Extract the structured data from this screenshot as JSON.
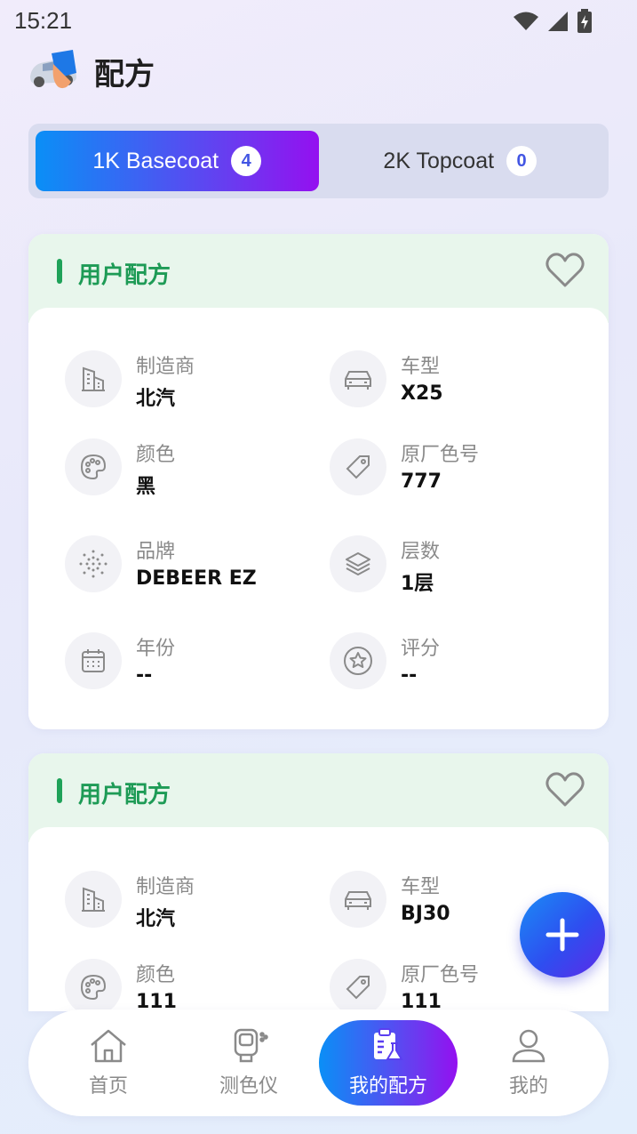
{
  "status_bar": {
    "time": "15:21"
  },
  "header": {
    "title": "配方"
  },
  "tabs": [
    {
      "label": "1K Basecoat",
      "count": "4",
      "active": true
    },
    {
      "label": "2K Topcoat",
      "count": "0",
      "active": false
    }
  ],
  "cards": [
    {
      "title": "用户配方",
      "fields": [
        {
          "icon": "building-icon",
          "label": "制造商",
          "value": "北汽"
        },
        {
          "icon": "car-icon",
          "label": "车型",
          "value": "X25"
        },
        {
          "icon": "palette-icon",
          "label": "颜色",
          "value": "黑"
        },
        {
          "icon": "tag-icon",
          "label": "原厂色号",
          "value": "777"
        },
        {
          "icon": "dots-circle-icon",
          "label": "品牌",
          "value": "DEBEER EZ"
        },
        {
          "icon": "layers-icon",
          "label": "层数",
          "value": "1层"
        },
        {
          "icon": "calendar-icon",
          "label": "年份",
          "value": "--"
        },
        {
          "icon": "star-icon",
          "label": "评分",
          "value": "--"
        }
      ]
    },
    {
      "title": "用户配方",
      "fields": [
        {
          "icon": "building-icon",
          "label": "制造商",
          "value": "北汽"
        },
        {
          "icon": "car-icon",
          "label": "车型",
          "value": "BJ30"
        },
        {
          "icon": "palette-icon",
          "label": "颜色",
          "value": "111"
        },
        {
          "icon": "tag-icon",
          "label": "原厂色号",
          "value": "111"
        }
      ]
    }
  ],
  "bottom_nav": [
    {
      "label": "首页",
      "icon": "home-icon",
      "active": false
    },
    {
      "label": "测色仪",
      "icon": "colorimeter-icon",
      "active": false
    },
    {
      "label": "我的配方",
      "icon": "recipe-icon",
      "active": true
    },
    {
      "label": "我的",
      "icon": "user-icon",
      "active": false
    }
  ],
  "colors": {
    "accent_gradient_start": "#0a8ff6",
    "accent_gradient_end": "#9410f0",
    "card_header_bg": "#e8f6ec",
    "card_title": "#1e9b56"
  }
}
